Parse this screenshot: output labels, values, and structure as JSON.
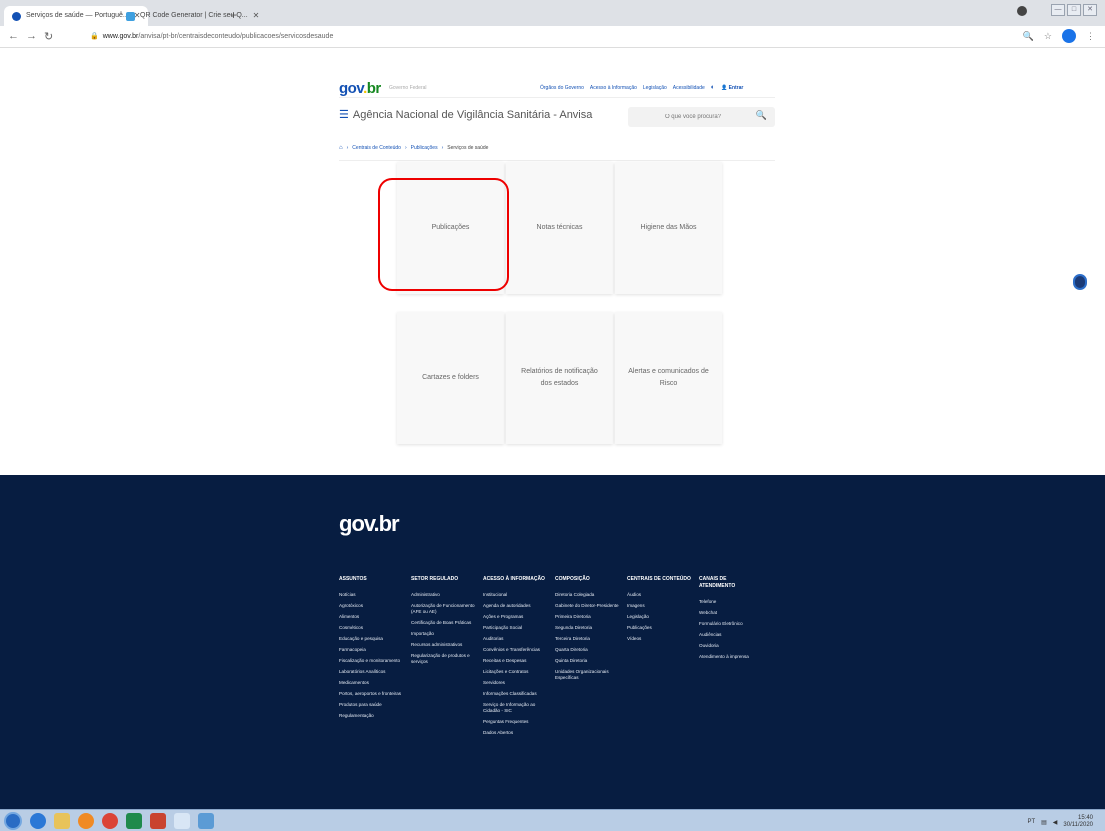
{
  "browser": {
    "tabs": [
      {
        "label": "Serviços de saúde — Portuguê...",
        "active": true
      },
      {
        "label": "QR Code Generator | Crie seu Q...",
        "active": false
      }
    ],
    "new_tab": "+",
    "window_controls": [
      "—",
      "□",
      "✕"
    ],
    "url_domain": "www.gov.br",
    "url_path": "/anvisa/pt-br/centraisdeconteudo/publicacoes/servicosdesaude"
  },
  "header": {
    "logo": {
      "gov": "gov",
      "dot": ".",
      "br": "br"
    },
    "subtitle": "Governo Federal",
    "links": [
      "Órgãos do Governo",
      "Acesso à Informação",
      "Legislação",
      "Acessibilidade"
    ],
    "login": "Entrar",
    "agency_title": "Agência Nacional de Vigilância Sanitária - Anvisa",
    "search_placeholder": "O que você procura?"
  },
  "breadcrumb": [
    "Centrais de Conteúdo",
    "Publicações",
    "Serviços de saúde"
  ],
  "cards": [
    "Publicações",
    "Notas técnicas",
    "Higiene das Mãos",
    "Cartazes e folders",
    "Relatórios de notificação dos estados",
    "Alertas e comunicados de Risco"
  ],
  "footer": {
    "logo": "gov.br",
    "columns": [
      {
        "title": "ASSUNTOS",
        "items": [
          "Notícias",
          "Agrotóxicos",
          "Alimentos",
          "Cosméticos",
          "Educação e pesquisa",
          "Farmacopeia",
          "Fiscalização e monitoramento",
          "Laboratórios Analíticos",
          "Medicamentos",
          "Portos, aeroportos e fronteiras",
          "Produtos para saúde",
          "Regulamentação"
        ]
      },
      {
        "title": "SETOR REGULADO",
        "items": [
          "Administrativo",
          "Autorização de Funcionamento (AFE ou AE)",
          "Certificação de Boas Práticas",
          "Importação",
          "Recursos administrativos",
          "Regularização de produtos e serviços"
        ]
      },
      {
        "title": "ACESSO À INFORMAÇÃO",
        "items": [
          "Institucional",
          "Agenda de autoridades",
          "Ações e Programas",
          "Participação Social",
          "Auditorias",
          "Convênios e Transferências",
          "Receitas e Despesas",
          "Licitações e Contratos",
          "Servidores",
          "Informações Classificadas",
          "Serviço de Informação ao Cidadão - SIC",
          "Perguntas Frequentes",
          "Dados Abertos"
        ]
      },
      {
        "title": "COMPOSIÇÃO",
        "items": [
          "Diretoria Colegiada",
          "Gabinete do Diretor-Presidente",
          "Primeira Diretoria",
          "Segunda Diretoria",
          "Terceira Diretoria",
          "Quarta Diretoria",
          "Quinta Diretoria",
          "Unidades Organizacionais Específicas"
        ]
      },
      {
        "title": "CENTRAIS DE CONTEÚDO",
        "items": [
          "Áudios",
          "Imagens",
          "Legislação",
          "Publicações",
          "Vídeos"
        ]
      },
      {
        "title": "CANAIS DE ATENDIMENTO",
        "items": [
          "Telefone",
          "Webchat",
          "Formulário Eletrônico",
          "Audiências",
          "Ouvidoria",
          "Atendimento à imprensa"
        ]
      }
    ]
  },
  "taskbar": {
    "clock": "15:40",
    "date": "30/11/2020",
    "lang": "PT"
  }
}
